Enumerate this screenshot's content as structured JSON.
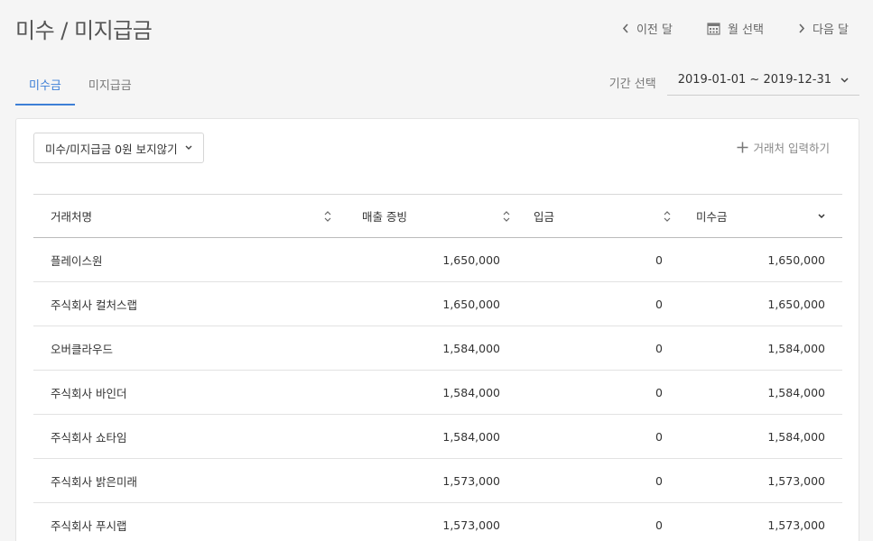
{
  "page": {
    "title": "미수 / 미지급금"
  },
  "nav": {
    "prev_label": "이전 달",
    "select_label": "월 선택",
    "next_label": "다음 달"
  },
  "tabs": [
    {
      "label": "미수금",
      "active": true
    },
    {
      "label": "미지급금",
      "active": false
    }
  ],
  "period": {
    "label": "기간 선택",
    "value": "2019-01-01 ~ 2019-12-31"
  },
  "filter": {
    "label": "미수/미지급금 0원 보지않기"
  },
  "add_partner": {
    "label": "거래처 입력하기"
  },
  "table": {
    "columns": [
      "거래처명",
      "매출 증빙",
      "입금",
      "미수금"
    ],
    "rows": [
      [
        "플레이스원",
        "1,650,000",
        "0",
        "1,650,000"
      ],
      [
        "주식회사 컬처스랩",
        "1,650,000",
        "0",
        "1,650,000"
      ],
      [
        "오버클라우드",
        "1,584,000",
        "0",
        "1,584,000"
      ],
      [
        "주식회사 바인더",
        "1,584,000",
        "0",
        "1,584,000"
      ],
      [
        "주식회사 쇼타임",
        "1,584,000",
        "0",
        "1,584,000"
      ],
      [
        "주식회사 밝은미래",
        "1,573,000",
        "0",
        "1,573,000"
      ],
      [
        "주식회사 푸시랩",
        "1,573,000",
        "0",
        "1,573,000"
      ]
    ]
  },
  "colors": {
    "accent": "#3d7fd6"
  }
}
